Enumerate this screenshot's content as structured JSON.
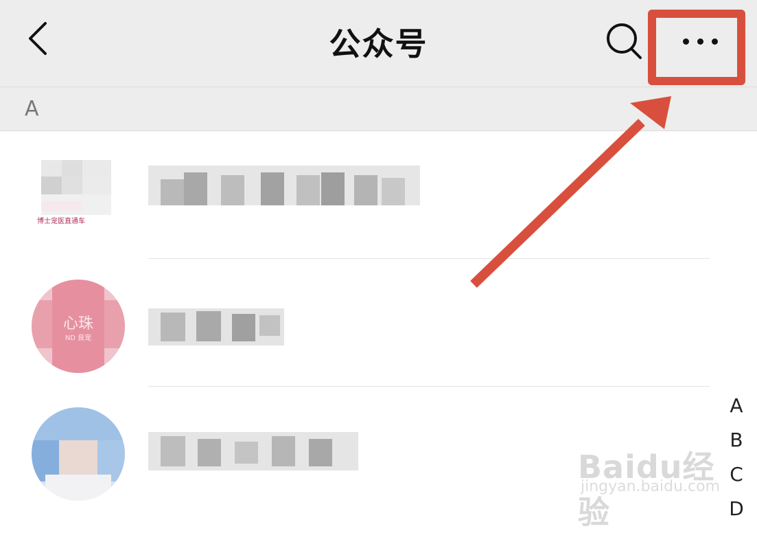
{
  "header": {
    "title": "公众号"
  },
  "section": {
    "letter": "A"
  },
  "accounts": [
    {
      "avatar_caption": "博士宠医直通车"
    },
    {
      "avatar_text": "心珠",
      "avatar_subtext": "ND 良宠"
    },
    {}
  ],
  "index_letters": [
    "A",
    "B",
    "C",
    "D"
  ],
  "watermark": {
    "brand": "Baidu经验",
    "url": "jingyan.baidu.com"
  },
  "colors": {
    "highlight": "#d8503d",
    "header_bg": "#ededed"
  },
  "icons": [
    "back-icon",
    "search-icon",
    "more-icon",
    "arrow-annotation"
  ]
}
